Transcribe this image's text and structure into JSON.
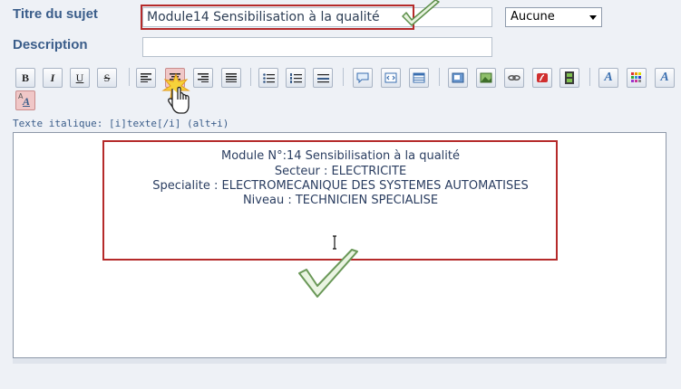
{
  "form": {
    "title_label": "Titre du sujet",
    "title_value": "Module14 Sensibilisation à la qualité",
    "description_label": "Description",
    "description_value": "",
    "icon_select": {
      "selected": "Aucune"
    }
  },
  "toolbar": {
    "buttons": [
      {
        "name": "bold",
        "label": "B"
      },
      {
        "name": "italic",
        "label": "I"
      },
      {
        "name": "underline",
        "label": "U"
      },
      {
        "name": "strike",
        "label": "S"
      },
      {
        "name": "align-left",
        "label": ""
      },
      {
        "name": "align-center",
        "label": ""
      },
      {
        "name": "align-right",
        "label": ""
      },
      {
        "name": "justify",
        "label": ""
      },
      {
        "name": "bullet-list",
        "label": ""
      },
      {
        "name": "numbered-list",
        "label": ""
      },
      {
        "name": "horizontal-rule",
        "label": ""
      },
      {
        "name": "quote",
        "label": ""
      },
      {
        "name": "code",
        "label": ""
      },
      {
        "name": "table",
        "label": ""
      },
      {
        "name": "image-host",
        "label": ""
      },
      {
        "name": "image",
        "label": ""
      },
      {
        "name": "link",
        "label": ""
      },
      {
        "name": "flash",
        "label": ""
      },
      {
        "name": "video",
        "label": ""
      },
      {
        "name": "font-face",
        "label": "A"
      },
      {
        "name": "color",
        "label": ""
      },
      {
        "name": "font-size",
        "label": "A"
      },
      {
        "name": "text-effect",
        "label": "A"
      }
    ],
    "active": "align-center"
  },
  "help_text": "Texte italique: [i]texte[/i] (alt+i)",
  "editor": {
    "lines": [
      "Module N°:14 Sensibilisation à la qualité",
      "Secteur : ELECTRICITE",
      "Specialite : ELECTROMECANIQUE DES SYSTEMES AUTOMATISES",
      "Niveau : TECHNICIEN SPECIALISE"
    ]
  },
  "colors": {
    "label": "#3a5d8a",
    "highlight": "#b52a2a",
    "check": "#6fa55a",
    "active_button": "#f0c7c7"
  },
  "icons": [
    "checkmark-icon",
    "hand-pointer-icon",
    "caret-down-icon"
  ]
}
